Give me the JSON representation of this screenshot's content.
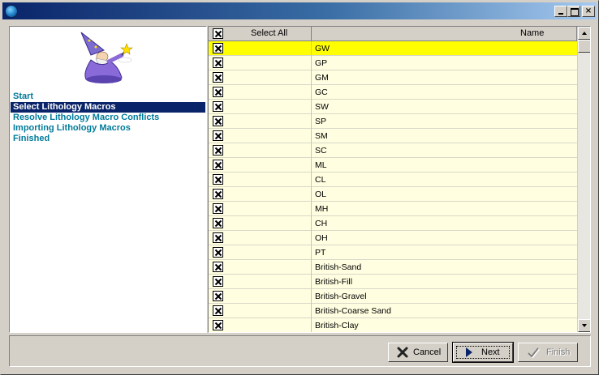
{
  "window": {
    "title": "",
    "controls": {
      "minimize": "",
      "maximize": "",
      "close": "×"
    }
  },
  "wizard": {
    "illustration": "wizard-icon",
    "steps": [
      {
        "label": "Start",
        "active": false
      },
      {
        "label": "Select Lithology Macros",
        "active": true
      },
      {
        "label": "Resolve Lithology Macro Conflicts",
        "active": false
      },
      {
        "label": "Importing Lithology Macros",
        "active": false
      },
      {
        "label": "Finished",
        "active": false
      }
    ]
  },
  "grid": {
    "columns": {
      "select_all": "Select All",
      "name": "Name"
    },
    "select_all_checked": true,
    "rows": [
      {
        "name": "GW",
        "checked": true,
        "selected": true
      },
      {
        "name": "GP",
        "checked": true
      },
      {
        "name": "GM",
        "checked": true
      },
      {
        "name": "GC",
        "checked": true
      },
      {
        "name": "SW",
        "checked": true
      },
      {
        "name": "SP",
        "checked": true
      },
      {
        "name": "SM",
        "checked": true
      },
      {
        "name": "SC",
        "checked": true
      },
      {
        "name": "ML",
        "checked": true
      },
      {
        "name": "CL",
        "checked": true
      },
      {
        "name": "OL",
        "checked": true
      },
      {
        "name": "MH",
        "checked": true
      },
      {
        "name": "CH",
        "checked": true
      },
      {
        "name": "OH",
        "checked": true
      },
      {
        "name": "PT",
        "checked": true
      },
      {
        "name": "British-Sand",
        "checked": true
      },
      {
        "name": "British-Fill",
        "checked": true
      },
      {
        "name": "British-Gravel",
        "checked": true
      },
      {
        "name": "British-Coarse Sand",
        "checked": true
      },
      {
        "name": "British-Clay",
        "checked": true
      }
    ]
  },
  "buttons": {
    "cancel": "Cancel",
    "next": "Next",
    "finish": "Finish"
  },
  "colors": {
    "titlebar_start": "#0a246a",
    "selected_step": "#0a246a",
    "step_text": "#007a99",
    "row_selected": "#ffff00",
    "grid_background": "#fffee0"
  }
}
